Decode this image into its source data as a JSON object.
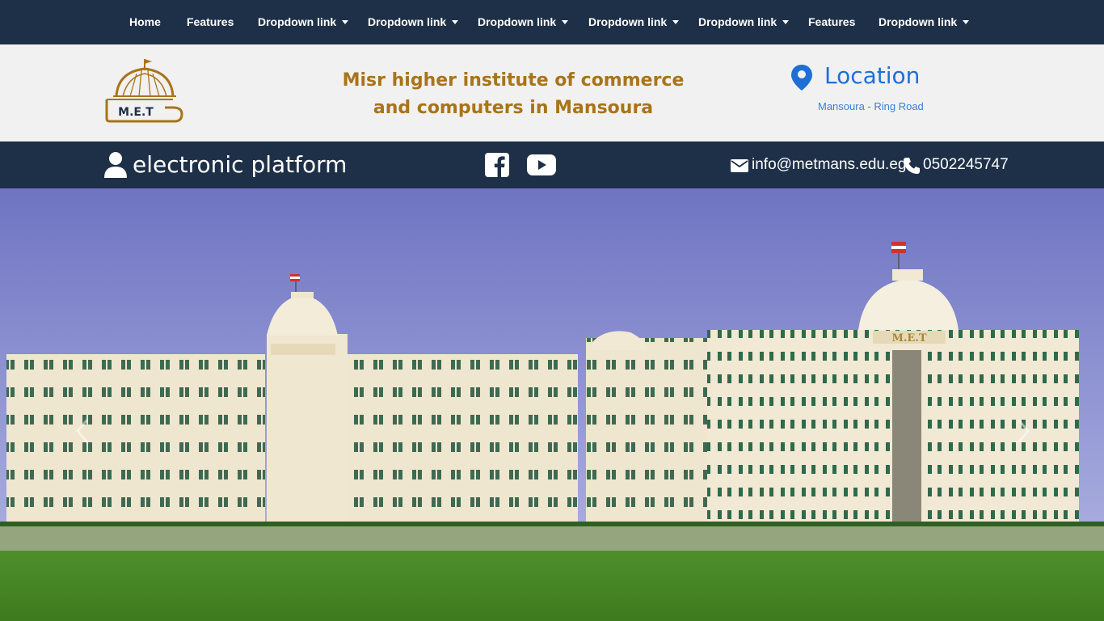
{
  "nav": {
    "items": [
      {
        "label": "Home",
        "dropdown": false
      },
      {
        "label": "Features",
        "dropdown": false
      },
      {
        "label": "Dropdown link",
        "dropdown": true
      },
      {
        "label": "Dropdown link",
        "dropdown": true
      },
      {
        "label": "Dropdown link",
        "dropdown": true
      },
      {
        "label": "Dropdown link",
        "dropdown": true
      },
      {
        "label": "Dropdown link",
        "dropdown": true
      },
      {
        "label": "Features",
        "dropdown": false
      },
      {
        "label": "Dropdown link",
        "dropdown": true
      }
    ]
  },
  "header": {
    "logo_text": "M.E.T",
    "title": "Misr higher institute of commerce and computers in Mansoura",
    "location_title": "Location",
    "location_address": "Mansoura - Ring Road"
  },
  "infobar": {
    "platform_label": "electronic platform",
    "email": "info@metmans.edu.eg",
    "phone": "0502245747"
  },
  "hero": {
    "building_sign": "M.E.T"
  },
  "colors": {
    "navy": "#1e3048",
    "gold": "#a8741a",
    "link_blue": "#1d6fd6",
    "header_bg": "#f1f1f1"
  },
  "icons": [
    "user-icon",
    "facebook-icon",
    "youtube-icon",
    "envelope-icon",
    "phone-icon",
    "map-pin-icon",
    "chevron-left-icon",
    "chevron-right-icon"
  ]
}
